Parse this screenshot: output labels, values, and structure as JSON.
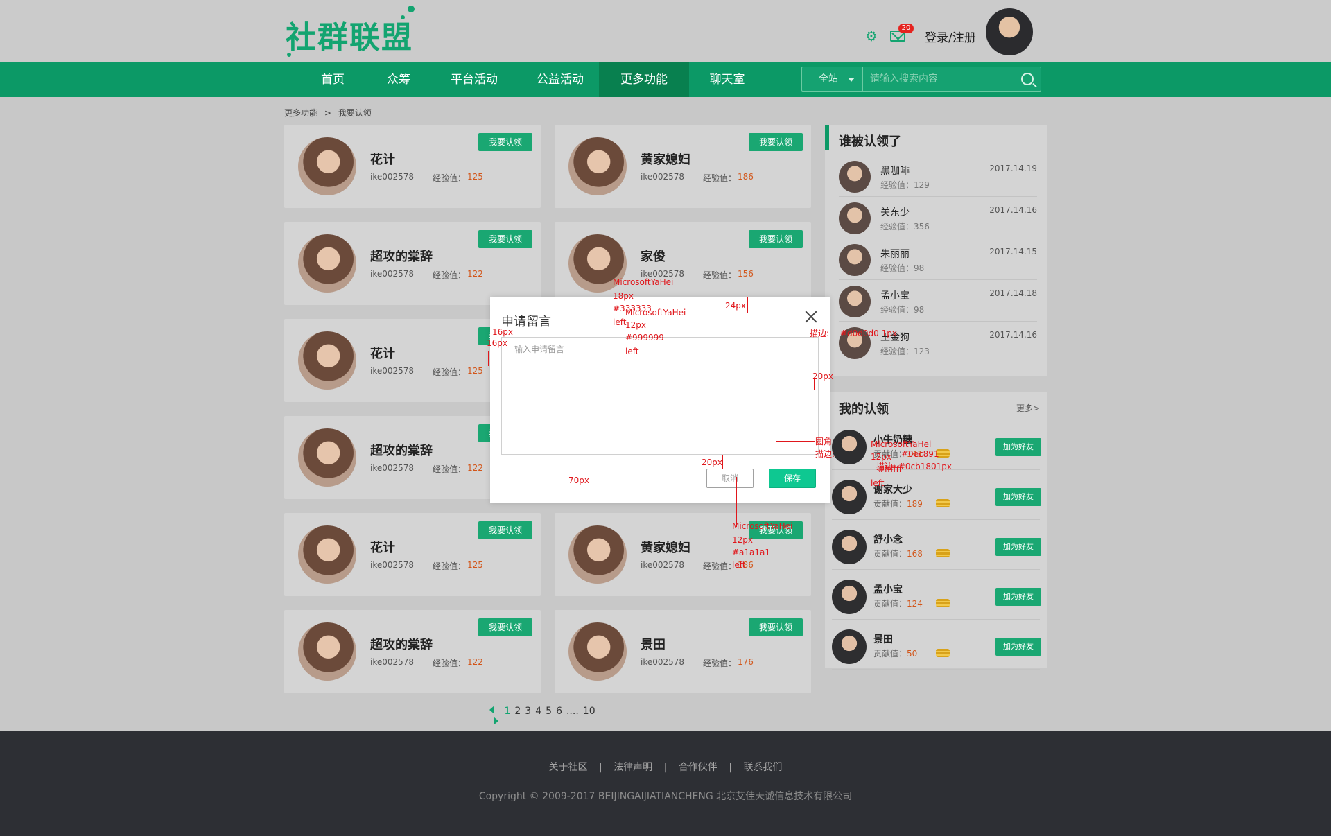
{
  "header": {
    "logo": "社群联盟",
    "mail_badge": "20",
    "login": "登录/注册"
  },
  "nav": {
    "items": [
      {
        "label": "首页"
      },
      {
        "label": "众筹"
      },
      {
        "label": "平台活动"
      },
      {
        "label": "公益活动"
      },
      {
        "label": "更多功能"
      },
      {
        "label": "聊天室"
      }
    ],
    "active_index": 4
  },
  "search": {
    "scope": "全站",
    "placeholder": "请输入搜索内容"
  },
  "breadcrumb": [
    "更多功能",
    ">",
    "我要认领"
  ],
  "cards": [
    {
      "name": "花计",
      "id": "ike002578",
      "exp_label": "经验值：",
      "exp": "125",
      "button": "我要认领"
    },
    {
      "name": "黄家媳妇",
      "id": "ike002578",
      "exp_label": "经验值：",
      "exp": "186",
      "button": "我要认领"
    },
    {
      "name": "超攻的棠辞",
      "id": "ike002578",
      "exp_label": "经验值：",
      "exp": "122",
      "button": "我要认领"
    },
    {
      "name": "家俊",
      "id": "ike002578",
      "exp_label": "经验值：",
      "exp": "156",
      "button": "我要认领"
    },
    {
      "name": "花计",
      "id": "ike002578",
      "exp_label": "经验值：",
      "exp": "125",
      "button": "我要认领"
    },
    {
      "name": "超攻的棠辞",
      "id": "ike002578",
      "exp_label": "经验值：",
      "exp": "122",
      "button": "我要认领"
    },
    {
      "name": "花计",
      "id": "ike002578",
      "exp_label": "经验值：",
      "exp": "125",
      "button": "我要认领"
    },
    {
      "name": "黄家媳妇",
      "id": "ike002578",
      "exp_label": "经验值：",
      "exp": "186",
      "button": "我要认领"
    },
    {
      "name": "超攻的棠辞",
      "id": "ike002578",
      "exp_label": "经验值：",
      "exp": "122",
      "button": "我要认领"
    },
    {
      "name": "景田",
      "id": "ike002578",
      "exp_label": "经验值：",
      "exp": "176",
      "button": "我要认领"
    }
  ],
  "who_claimed": {
    "title": "谁被认领了",
    "rows": [
      {
        "name": "黑咖啡",
        "exp": "经验值：129",
        "date": "2017.14.19"
      },
      {
        "name": "关东少",
        "exp": "经验值：356",
        "date": "2017.14.16"
      },
      {
        "name": "朱丽丽",
        "exp": "经验值：98",
        "date": "2017.14.15"
      },
      {
        "name": "孟小宝",
        "exp": "经验值：98",
        "date": "2017.14.18"
      },
      {
        "name": "王金狗",
        "exp": "经验值：123",
        "date": "2017.14.16"
      }
    ]
  },
  "my_claims": {
    "title": "我的认领",
    "more": "更多>",
    "rows": [
      {
        "name": "小牛奶糖",
        "contrib_label": "贡献值：",
        "contrib": "141",
        "button": "加为好友"
      },
      {
        "name": "谢家大少",
        "contrib_label": "贡献值：",
        "contrib": "189",
        "button": "加为好友"
      },
      {
        "name": "舒小念",
        "contrib_label": "贡献值：",
        "contrib": "168",
        "button": "加为好友"
      },
      {
        "name": "孟小宝",
        "contrib_label": "贡献值：",
        "contrib": "124",
        "button": "加为好友"
      },
      {
        "name": "景田",
        "contrib_label": "贡献值：",
        "contrib": "50",
        "button": "加为好友"
      }
    ]
  },
  "pager": {
    "pages": [
      "1",
      "2",
      "3",
      "4",
      "5",
      "6",
      "....",
      "10"
    ],
    "current": "1"
  },
  "footer": {
    "links": [
      "关于社区",
      "|",
      "法律声明",
      "|",
      "合作伙伴",
      "|",
      "联系我们"
    ],
    "copyright": "Copyright © 2009-2017 BEIJINGAIJIATIANCHENG 北京艾佳天诚信息技术有限公司"
  },
  "modal": {
    "title": "申请留言",
    "placeholder": "输入申请留言",
    "cancel": "取消",
    "save": "保存"
  },
  "annotations": {
    "a1": "MicrosoftYaHei",
    "a2": "18px",
    "a3": "#333333",
    "a4": "MicrosoftYaHei",
    "a5": "left",
    "a6": "12px",
    "a7": "#999999",
    "a8": "left",
    "a9": "24px",
    "a10": "16px",
    "a11": "16px",
    "a12": "描边:",
    "a13": "#d0d0d0 1px",
    "a14": "20px",
    "a15": "圆角",
    "a16": "MicrosoftYaHei",
    "a17": "描边:",
    "a18": "12px",
    "a19": "#0ec891",
    "a20": "#ffffff",
    "a21": "描边: #0cb1801px",
    "a22": "left",
    "a23": "20px",
    "a24": "70px",
    "a25": "MicrosoftYaHei",
    "a26": "12px",
    "a27": "#a1a1a1",
    "a28": "left"
  }
}
